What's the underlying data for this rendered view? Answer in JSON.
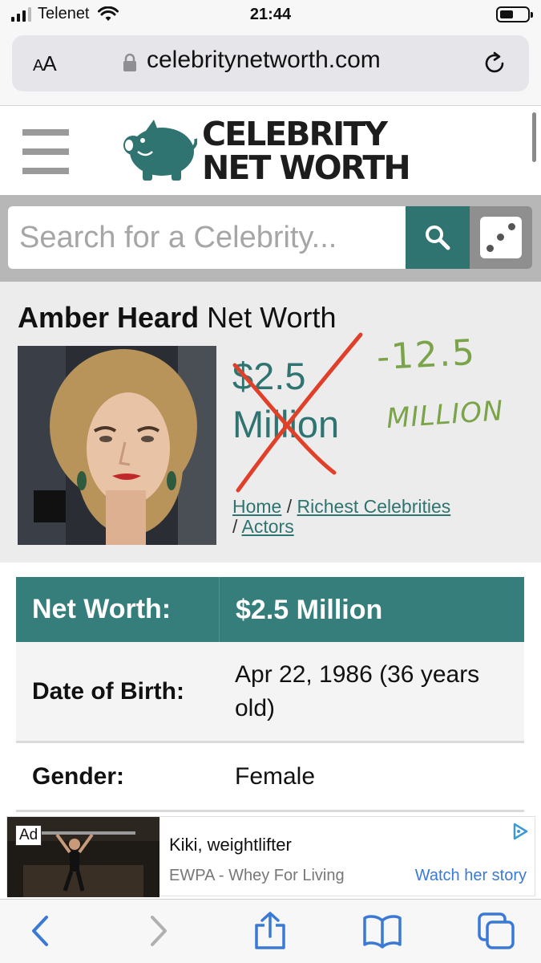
{
  "status_bar": {
    "carrier": "Telenet",
    "time": "21:44"
  },
  "browser": {
    "text_size_label": "AA",
    "url": "celebritynetworth.com"
  },
  "site": {
    "logo_line1": "CELEBRITY",
    "logo_line2": "NET WORTH",
    "search_placeholder": "Search for a Celebrity..."
  },
  "profile": {
    "name": "Amber Heard",
    "title_suffix": "Net Worth",
    "net_worth_line1": "$2.5",
    "net_worth_line2": "Million",
    "handwritten_line1": "-12.5",
    "handwritten_line2": "MILLION",
    "breadcrumb": {
      "home": "Home",
      "sep1": " / ",
      "richest": "Richest Celebrities",
      "sep2": "/ ",
      "actors": "Actors"
    }
  },
  "facts": [
    {
      "label": "Net Worth:",
      "value": "$2.5 Million"
    },
    {
      "label": "Date of Birth:",
      "value": "Apr 22, 1986 (36 years old)"
    },
    {
      "label": "Gender:",
      "value": "Female"
    }
  ],
  "ad": {
    "badge": "Ad",
    "title": "Kiki, weightlifter",
    "source": "EWPA - Whey For Living",
    "cta": "Watch her story"
  },
  "colors": {
    "brand_teal": "#2f7470",
    "table_header": "#357e7b",
    "annotation_red": "#e0402a",
    "annotation_green": "#7aa34a",
    "link_blue": "#3b79d6"
  }
}
